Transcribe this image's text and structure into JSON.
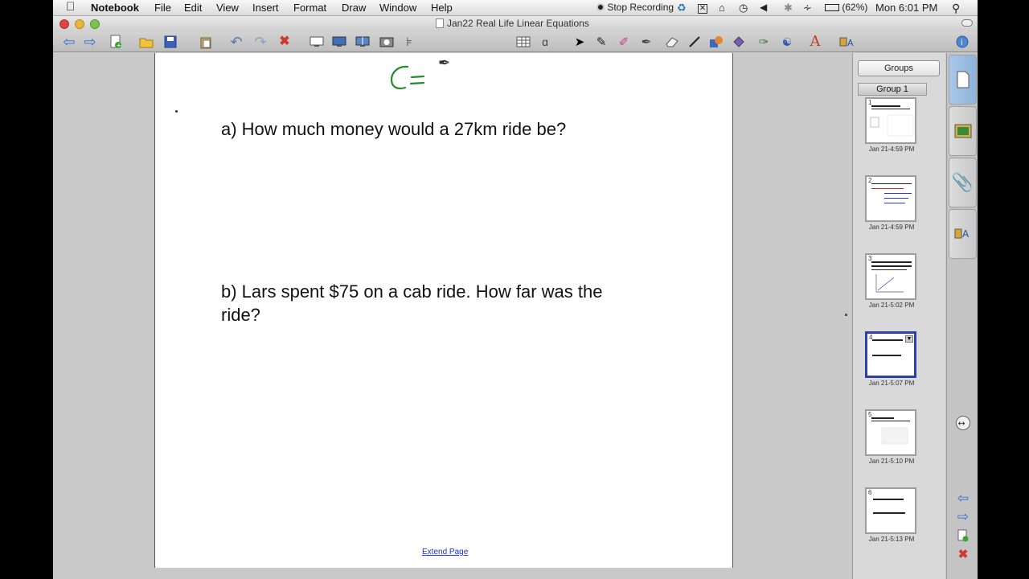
{
  "menubar": {
    "app_name": "Notebook",
    "menus": [
      "File",
      "Edit",
      "View",
      "Insert",
      "Format",
      "Draw",
      "Window",
      "Help"
    ],
    "stop_recording": "Stop Recording",
    "battery": "(62%)",
    "clock": "Mon 6:01 PM"
  },
  "window": {
    "title": "Jan22 Real Life Linear Equations"
  },
  "toolbar": {
    "icons": [
      "back-icon",
      "forward-icon",
      "add-page-icon",
      "open-folder-icon",
      "save-icon",
      "paste-icon",
      "undo-icon",
      "redo-icon",
      "delete-icon",
      "screen-shade-icon",
      "full-screen-icon",
      "dual-display-icon",
      "capture-icon",
      "table-tool-icon",
      "table-icon",
      "spelling-icon",
      "select-arrow-icon",
      "pen-icon",
      "creative-pen-icon",
      "magic-pen-icon",
      "eraser-icon",
      "line-icon",
      "shape-icon",
      "fill-icon",
      "properties-pen-icon",
      "highlighter-icon",
      "text-icon",
      "gallery-icon",
      "info-icon"
    ]
  },
  "page": {
    "formula_text": "C=",
    "question_a": "a) How much money would a 27km ride be?",
    "question_b": "b) Lars spent $75 on a cab ride. How far was the ride?",
    "extend_link": "Extend Page",
    "formula_color": "#2a8a2a"
  },
  "sidebar": {
    "groups_button": "Groups",
    "group_tab": "Group 1",
    "thumbnails": [
      {
        "number": "1",
        "label": "Jan 21-4:59 PM",
        "selected": false
      },
      {
        "number": "2",
        "label": "Jan 21-4:59 PM",
        "selected": false
      },
      {
        "number": "3",
        "label": "Jan 21-5:02 PM",
        "selected": false
      },
      {
        "number": "4",
        "label": "Jan 21-5:07 PM",
        "selected": true
      },
      {
        "number": "5",
        "label": "Jan 21-5:10 PM",
        "selected": false
      },
      {
        "number": "6",
        "label": "Jan 21-5:13 PM",
        "selected": false
      }
    ]
  },
  "rail": {
    "tabs": [
      "page-sorter-icon",
      "gallery-icon",
      "attachments-icon",
      "properties-icon"
    ],
    "buttons": [
      "move-sidebar-icon",
      "previous-page-icon",
      "next-page-icon",
      "add-page-icon",
      "delete-page-icon"
    ]
  },
  "colors": {
    "selection": "#2f3fa8",
    "link": "#1a33c8",
    "active_tab": "#9bbbe2"
  }
}
